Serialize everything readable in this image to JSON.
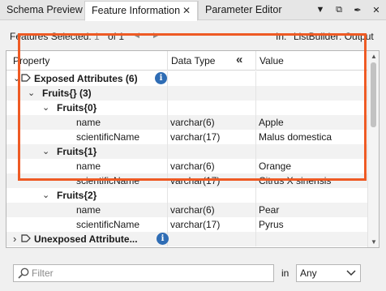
{
  "tabs": [
    {
      "label": "Schema Preview"
    },
    {
      "label": "Feature Information"
    },
    {
      "label": "Parameter Editor"
    }
  ],
  "tab_close_glyph": "✕",
  "window_controls": [
    {
      "glyph": "▼",
      "name": "dropdown-icon"
    },
    {
      "glyph": "⧉",
      "name": "float-window-icon"
    },
    {
      "glyph": "✒",
      "name": "pin-icon"
    },
    {
      "glyph": "✕",
      "name": "close-icon"
    }
  ],
  "features": {
    "label": "Features Selected:",
    "current": "1",
    "of": "of 1",
    "prev_glyph": "◀",
    "next_glyph": "▶",
    "in_label": "In:",
    "in_value": "ListBuilder: Output"
  },
  "table": {
    "headers": {
      "property": "Property",
      "data_type": "Data Type",
      "value": "Value"
    },
    "collapse_glyph": "«",
    "rows": [
      {
        "label": "Exposed Attributes (6)",
        "type": "",
        "value": "",
        "level": 0,
        "bold": true,
        "arrow": "⌄",
        "info": true,
        "tag": true
      },
      {
        "label": "Fruits{} (3)",
        "type": "",
        "value": "",
        "level": 1,
        "bold": true,
        "arrow": "⌄"
      },
      {
        "label": "Fruits{0}",
        "type": "",
        "value": "",
        "level": 2,
        "bold": true,
        "arrow": "⌄"
      },
      {
        "label": "name",
        "type": "varchar(6)",
        "value": "Apple",
        "level": 3
      },
      {
        "label": "scientificName",
        "type": "varchar(17)",
        "value": "Malus domestica",
        "level": 3
      },
      {
        "label": "Fruits{1}",
        "type": "",
        "value": "",
        "level": 2,
        "bold": true,
        "arrow": "⌄"
      },
      {
        "label": "name",
        "type": "varchar(6)",
        "value": "Orange",
        "level": 3
      },
      {
        "label": "scientificName",
        "type": "varchar(17)",
        "value": "Citrus X sinensis",
        "level": 3
      },
      {
        "label": "Fruits{2}",
        "type": "",
        "value": "",
        "level": 2,
        "bold": true,
        "arrow": "⌄"
      },
      {
        "label": "name",
        "type": "varchar(6)",
        "value": "Pear",
        "level": 3
      },
      {
        "label": "scientificName",
        "type": "varchar(17)",
        "value": "Pyrus",
        "level": 3
      },
      {
        "label": "Unexposed Attribute...",
        "type": "",
        "value": "",
        "level": 0,
        "bold": true,
        "arrow": "›",
        "info": true,
        "tag": true
      }
    ]
  },
  "info_glyph": "i",
  "filter": {
    "placeholder": "Filter",
    "in_text": "in",
    "select_value": "Any"
  },
  "colors": {
    "highlight": "#ee5a24",
    "info": "#2f6db5"
  }
}
